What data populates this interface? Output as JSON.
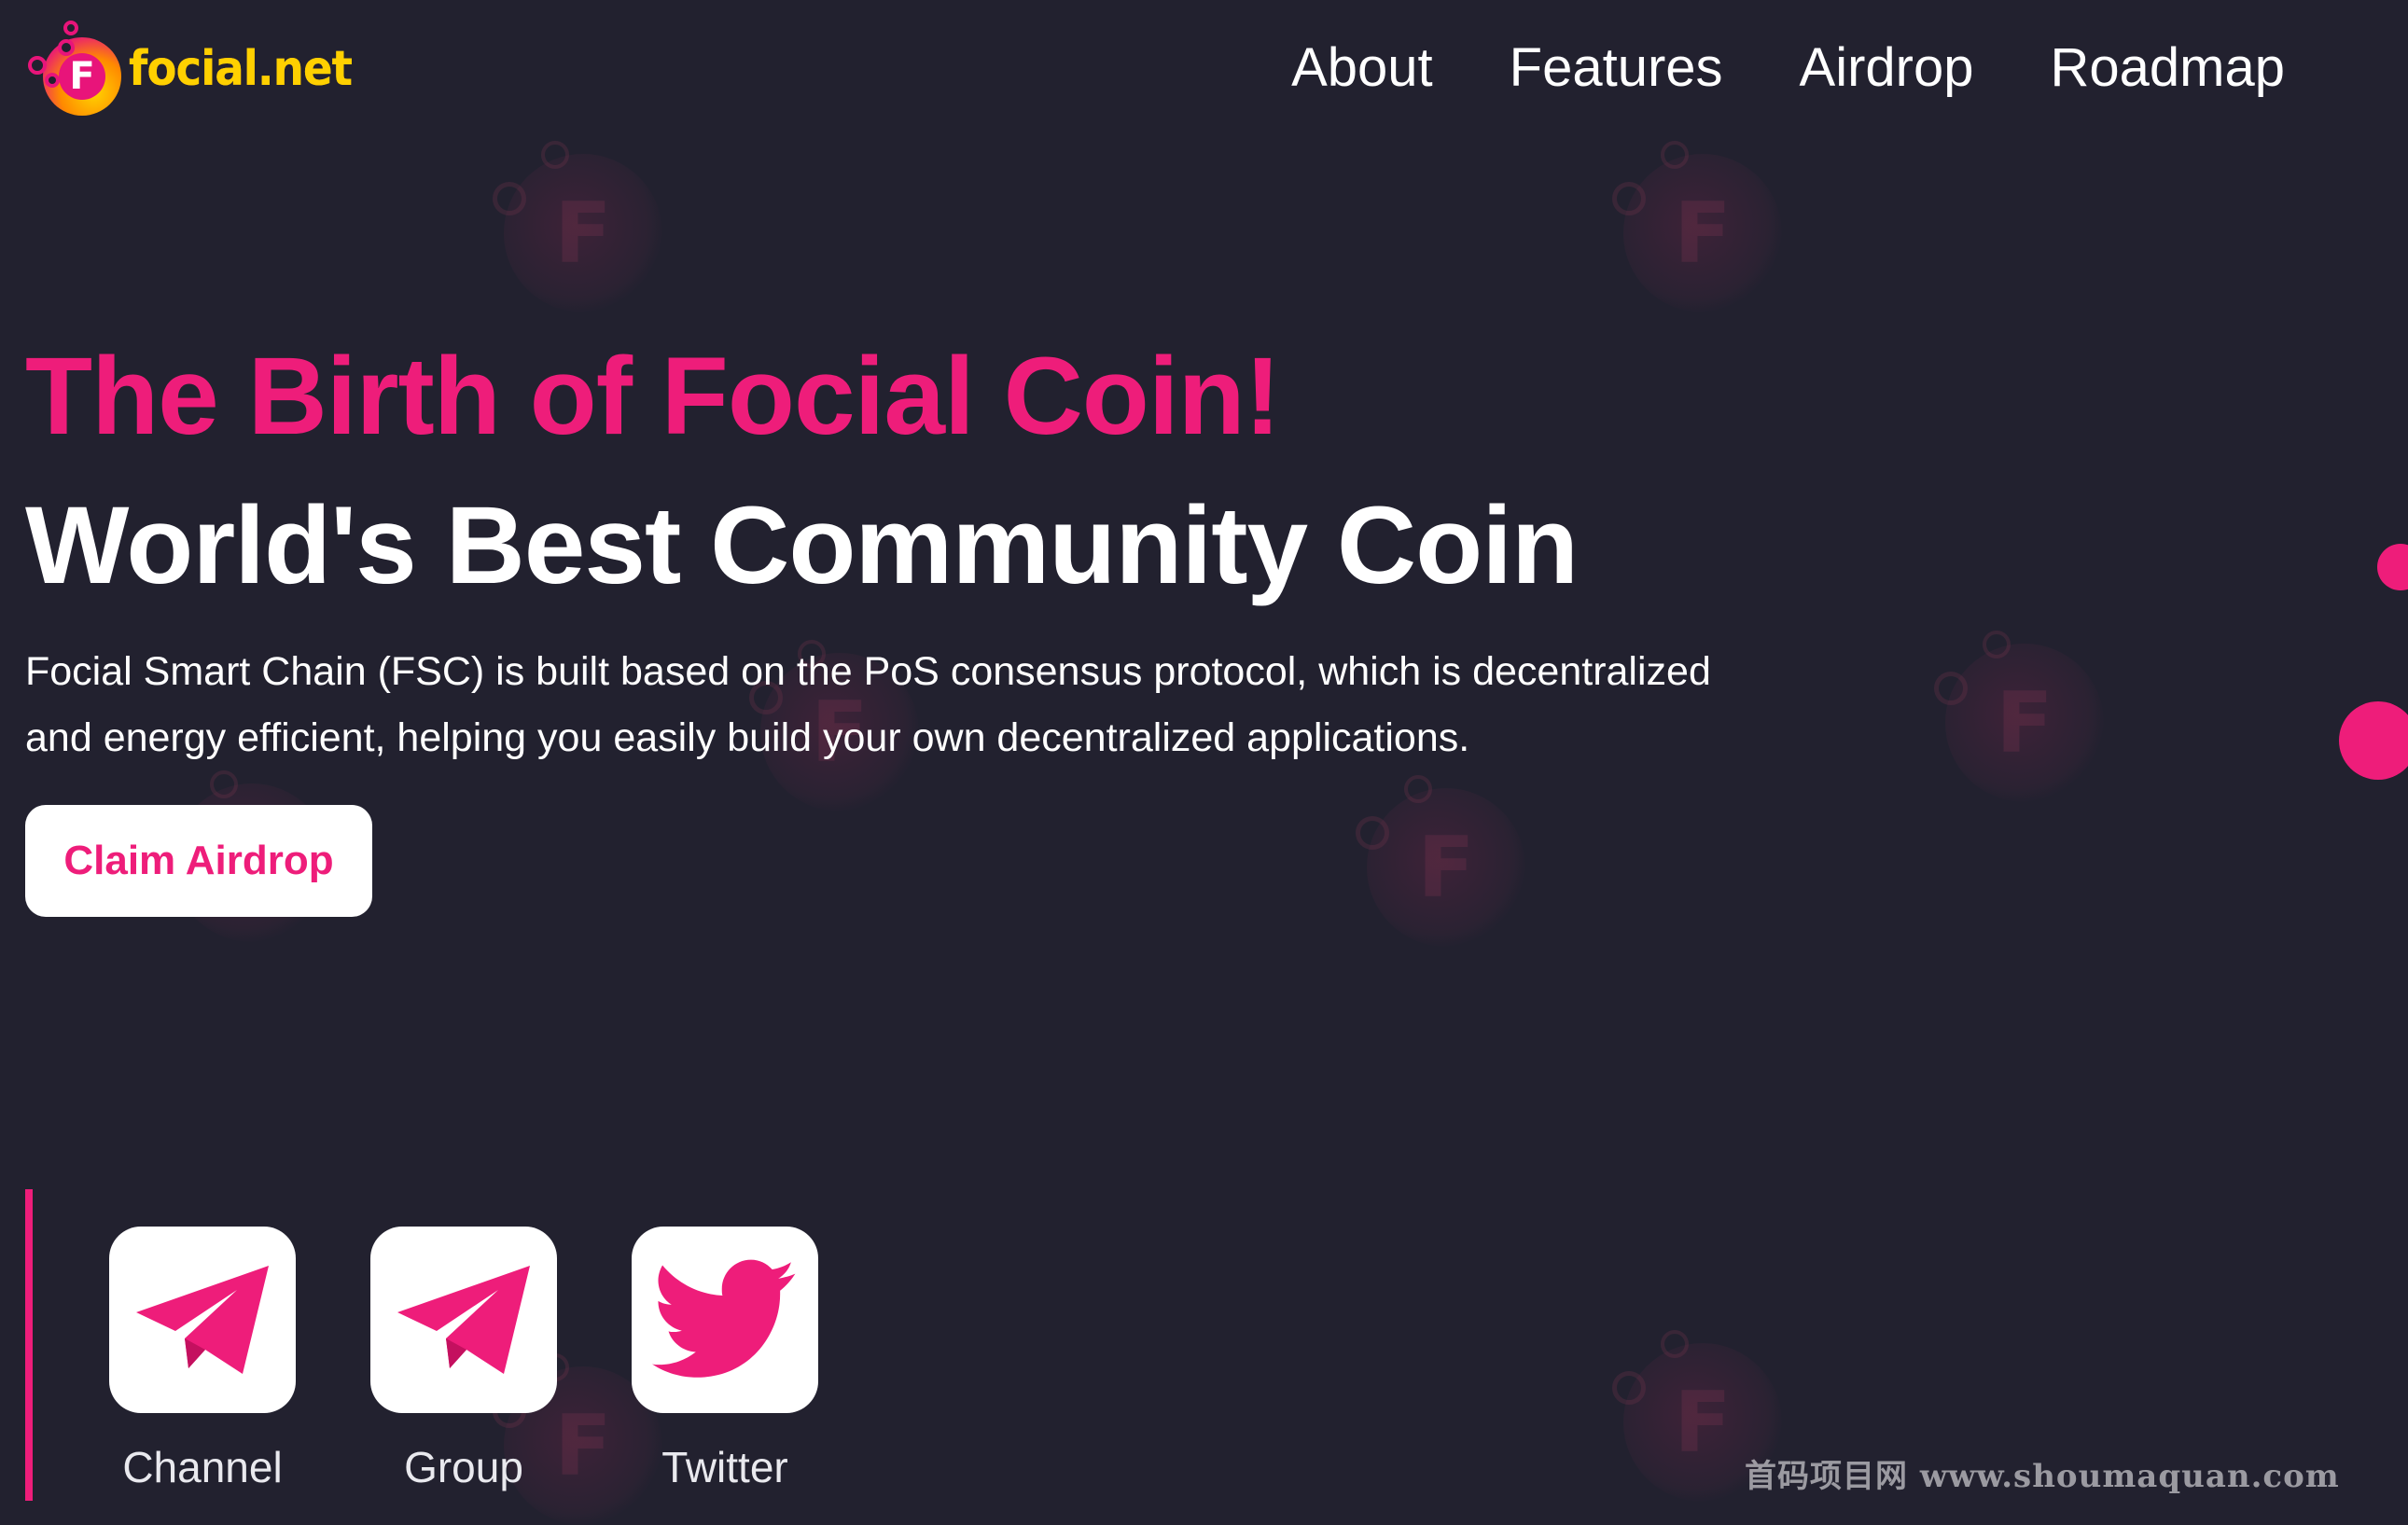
{
  "brand": {
    "logo_letter": "F",
    "name": "focial",
    "tld": ".net"
  },
  "nav": {
    "items": [
      "About",
      "Features",
      "Airdrop",
      "Roadmap"
    ]
  },
  "hero": {
    "title_line1": "The Birth of Focial Coin!",
    "title_line2": "World's Best Community Coin",
    "description": "Focial Smart Chain (FSC) is built based on the PoS consensus protocol, which is decentralized and energy efficient, helping you easily build your own decentralized applications.",
    "cta_label": "Claim Airdrop"
  },
  "socials": [
    {
      "label": "Channel",
      "icon": "telegram-icon"
    },
    {
      "label": "Group",
      "icon": "telegram-icon"
    },
    {
      "label": "Twitter",
      "icon": "twitter-icon"
    }
  ],
  "watermark": {
    "text": "首码项目网 www.shoumaquan.com"
  },
  "colors": {
    "background": "#22212f",
    "accent": "#ee1d7a",
    "text": "#ffffff"
  }
}
